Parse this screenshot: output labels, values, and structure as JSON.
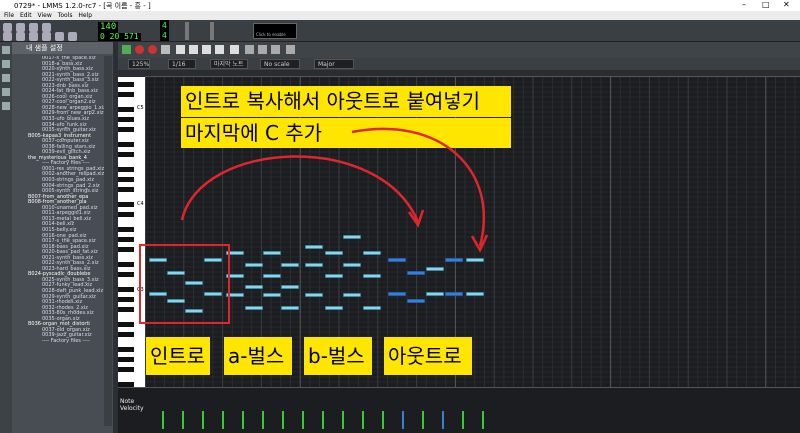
{
  "window": {
    "title": "0729* - LMMS 1.2.0-rc7 - [곡 이름 - 흥 - ]",
    "controls": [
      "–",
      "□",
      "✕"
    ]
  },
  "menu": [
    "File",
    "Edit",
    "View",
    "Tools",
    "Help"
  ],
  "transport": {
    "tempo": "140",
    "time_sig_top": "4",
    "time_sig_bottom": "4",
    "time_display": "0 20 571",
    "cpu_label": "Click to enable"
  },
  "sidebar": {
    "header": "내 샘플 설정",
    "files": [
      "0017-s_the_space.xiz",
      "0018-a_bass.xiz",
      "0020-synth_bass.xiz",
      "0021-synth_bass_2.xiz",
      "0022-synth_bass_3.xiz",
      "0023-dnb_bass.xiz",
      "0024-fat_dnb_bass.xiz",
      "0026-cool_organ.xiz",
      "0027-cool_organ2.xiz",
      "0028-new_arpeggio_1.xiz",
      "0029-from_new_arp2.xiz",
      "0033-ufo_blues.xiz",
      "0034-ufo_funk.xiz",
      "0035-synth_guitar.xiz",
      "B005-kapaa3_instrument",
      "0037-computer.xiz",
      "0038-falling_stars.xiz",
      "0039-evil_glitch.xiz",
      "the_mysterious_bank_4",
      "---- Factory files ----",
      "0001-res_strings_pad.xiz",
      "0002-another_respad.xiz",
      "0003-strings_pad.xiz",
      "0004-strings_pad_2.xiz",
      "0005-synth_strings.xiz",
      "B007-from_another_epa",
      "B008-from_another_pla",
      "0010-unamed_pad.xiz",
      "0011-arpeggio1.xiz",
      "0013-metal_bell.xiz",
      "0014-bell.xiz",
      "0015-belly.xiz",
      "0016-one_pad.xiz",
      "0017-s_the_space.xiz",
      "0018-bass_pad.xiz",
      "0020-bass_pad_fat.xiz",
      "0021-synth_bass.xiz",
      "0022-synth_bass_2.xiz",
      "0023-hard_bass.xiz",
      "B024-pyscadlc_doublebe",
      "0025-synth_bass_3.xiz",
      "0027-funky_lead.xiz",
      "0028-daft_punk_lead.xiz",
      "0029-synth_guitar.xiz",
      "0031-rhodes.xiz",
      "0032-rhodes_2.xiz",
      "0033-80s_rhodes.xiz",
      "0035-organ.xiz",
      "B036-organ_mot_distorti",
      "0037-old_organ.xiz",
      "0039-jazz_guitar.xiz",
      "---- Factory files ----"
    ]
  },
  "piano_roll": {
    "zoom": "125%",
    "quantize": "1/16",
    "note_length": "마지막 노트",
    "scale": "No scale",
    "chord": "Major",
    "key_labels": [
      "C5",
      "C4",
      "C3"
    ],
    "velocity_label": "Note Velocity"
  },
  "annotations": {
    "instruction_line1": "인트로 복사해서 아웃트로 붙여넣기",
    "instruction_line2": "마지막에 C 추가",
    "sections": [
      "인트로",
      "a-벌스",
      "b-벌스",
      "아웃트로"
    ]
  },
  "colors": {
    "note": "#8fd3e8",
    "outro_note": "#3a7fd6",
    "highlight": "#ffe600",
    "marker": "#e0262d"
  }
}
